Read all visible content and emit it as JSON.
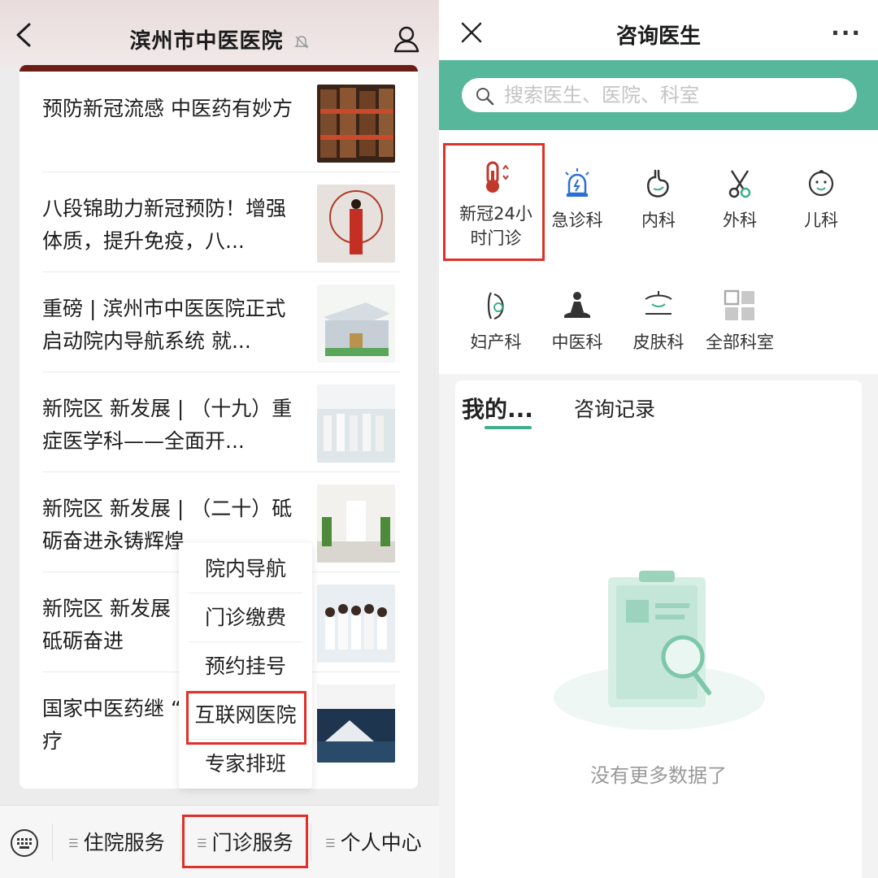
{
  "left": {
    "header": {
      "title": "滨州市中医医院"
    },
    "articles": [
      {
        "title": "预防新冠流感 中医药有妙方"
      },
      {
        "title": "八段锦助力新冠预防！增强体质，提升免疫，八..."
      },
      {
        "title": "重磅 | 滨州市中医医院正式启动院内导航系统 就..."
      },
      {
        "title": "新院区 新发展 | （十九）重症医学科——全面开..."
      },
      {
        "title": "新院区 新发展 | （二十）砥砺奋进永铸辉煌"
      },
      {
        "title": "新院区 新发展 | （二十一）砥砺奋进"
      },
      {
        "title": "国家中医药继 “三部六病诊疗"
      }
    ],
    "popup_menu": {
      "items": [
        "院内导航",
        "门诊缴费",
        "预约挂号",
        "互联网医院",
        "专家排班"
      ],
      "highlighted": "互联网医院"
    },
    "bottom_menu": {
      "items": [
        "住院服务",
        "门诊服务",
        "个人中心"
      ],
      "highlighted": "门诊服务"
    }
  },
  "right": {
    "header": {
      "title": "咨询医生",
      "more": "···"
    },
    "search": {
      "placeholder": "搜索医生、医院、科室"
    },
    "departments": [
      {
        "label": "新冠24小时门诊",
        "icon": "thermometer-icon"
      },
      {
        "label": "急诊科",
        "icon": "emergency-siren-icon"
      },
      {
        "label": "内科",
        "icon": "stomach-icon"
      },
      {
        "label": "外科",
        "icon": "scissors-icon"
      },
      {
        "label": "儿科",
        "icon": "baby-face-icon"
      },
      {
        "label": "妇产科",
        "icon": "pregnancy-icon"
      },
      {
        "label": "中医科",
        "icon": "meditation-icon"
      },
      {
        "label": "皮肤科",
        "icon": "skin-icon"
      },
      {
        "label": "全部科室",
        "icon": "grid-icon"
      }
    ],
    "highlighted_department": "新冠24小时门诊",
    "tabs": [
      {
        "label": "我的...",
        "active": true
      },
      {
        "label": "咨询记录",
        "active": false
      }
    ],
    "empty_text": "没有更多数据了"
  },
  "colors": {
    "accent_green": "#56b79a",
    "highlight_red": "#e0302a",
    "article_accent": "#6a1e16"
  }
}
